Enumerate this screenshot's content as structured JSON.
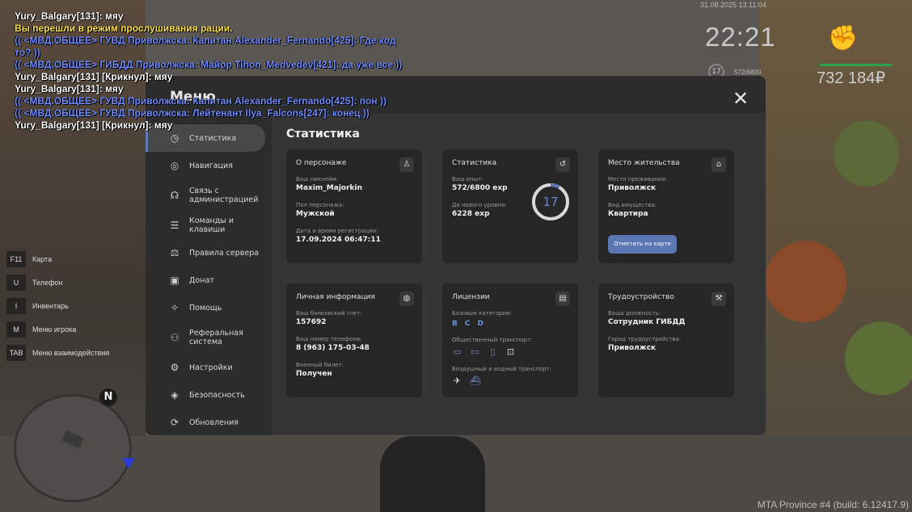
{
  "chat": [
    {
      "text": "Yury_Balgary[131]: мяу",
      "color": "white"
    },
    {
      "text": "Вы перешли в режим прослушивания рации.",
      "color": "yellow"
    },
    {
      "text": "(( <МВД.ОБЩЕЕ> ГУВД Приволжска: Капитан Alexander_Fernando[425]: Где код",
      "color": "blue"
    },
    {
      "text": "  то? ))",
      "color": "blue"
    },
    {
      "text": "(( <МВД.ОБЩЕЕ> ГИБДД Приволжска: Майор Tihon_Medvedev[421]: да уже все ))",
      "color": "blue"
    },
    {
      "text": "Yury_Balgary[131] [Крикнул]: мяу",
      "color": "white"
    },
    {
      "text": "Yury_Balgary[131]: мяу",
      "color": "white"
    },
    {
      "text": "(( <МВД.ОБЩЕЕ> ГУВД Приволжска: Капитан Alexander_Fernando[425]: пон ))",
      "color": "blue"
    },
    {
      "text": "(( <МВД.ОБЩЕЕ> ГУВД Приволжска: Лейтенант Ilya_Falcons[247]: конец ))",
      "color": "blue"
    },
    {
      "text": "Yury_Balgary[131] [Крикнул]: мяу",
      "color": "white"
    }
  ],
  "hud": {
    "datetime": "31.08.2025 13:11:04",
    "time": "22:21",
    "level": "17",
    "exp": "572/6800",
    "money": "732 184₽",
    "fist_icon": "fist-icon"
  },
  "keys": [
    {
      "key": "F11",
      "label": "Карта"
    },
    {
      "key": "U",
      "label": "Телефон"
    },
    {
      "key": "I",
      "label": "Инвентарь"
    },
    {
      "key": "M",
      "label": "Меню игрока"
    },
    {
      "key": "TAB",
      "label": "Меню взаимодействия"
    }
  ],
  "minimap": {
    "north": "N"
  },
  "build": "MTA Province #4 (build: 6.12417.9)",
  "menu": {
    "title": "Меню",
    "close": "✕",
    "section_title": "Статистика",
    "sidebar": [
      {
        "label": "Статистика",
        "icon": "clock-icon",
        "glyph": "◷",
        "active": true
      },
      {
        "label": "Навигация",
        "icon": "navigation-icon",
        "glyph": "◎"
      },
      {
        "label": "Связь с администрацией",
        "icon": "headset-icon",
        "glyph": "☊"
      },
      {
        "label": "Команды и клавиши",
        "icon": "list-icon",
        "glyph": "☰"
      },
      {
        "label": "Правила сервера",
        "icon": "scales-icon",
        "glyph": "⚖"
      },
      {
        "label": "Донат",
        "icon": "wallet-icon",
        "glyph": "▣"
      },
      {
        "label": "Помощь",
        "icon": "handshake-icon",
        "glyph": "✧"
      },
      {
        "label": "Реферальная система",
        "icon": "referral-icon",
        "glyph": "⚇"
      },
      {
        "label": "Настройки",
        "icon": "gear-icon",
        "glyph": "⚙"
      },
      {
        "label": "Безопасность",
        "icon": "shield-icon",
        "glyph": "◈"
      },
      {
        "label": "Обновления",
        "icon": "update-icon",
        "glyph": "⟳"
      }
    ],
    "cards": {
      "character": {
        "title": "О персонаже",
        "nick_label": "Ваш никнейм:",
        "nick": "Maxim_Majorkin",
        "gender_label": "Пол персонажа:",
        "gender": "Мужской",
        "reg_label": "Дата и время регистрации:",
        "reg": "17.09.2024 06:47:11"
      },
      "stats": {
        "title": "Статистика",
        "exp_label": "Ваш опыт:",
        "exp": "572/6800 exp",
        "next_label": "До нового уровня:",
        "next": "6228 exp",
        "level": "17",
        "progress": 0.084
      },
      "residence": {
        "title": "Место жительства",
        "place_label": "Место проживания:",
        "place": "Приволжск",
        "property_label": "Вид имущества:",
        "property": "Квартира",
        "button": "Отметить на карте"
      },
      "personal": {
        "title": "Личная информация",
        "bank_label": "Ваш банковский счет:",
        "bank": "157692",
        "phone_label": "Ваш номер телефона:",
        "phone": "8 (963) 175-03-48",
        "military_label": "Военный билет:",
        "military": "Получен"
      },
      "licenses": {
        "title": "Лицензии",
        "base_label": "Базовые категории:",
        "categories": [
          "B",
          "C",
          "D"
        ],
        "public_label": "Общественный транспорт:",
        "air_label": "Воздушный и водный транспорт:"
      },
      "job": {
        "title": "Трудоустройство",
        "position_label": "Ваша должность:",
        "position": "Сотрудник ГИБДД",
        "city_label": "Город трудоустройства:",
        "city": "Приволжск"
      }
    }
  },
  "colors": {
    "accent": "#5a77b3",
    "chat_blue": "#6f8bff",
    "chat_yellow": "#ffe14a",
    "health": "#2fa348"
  }
}
